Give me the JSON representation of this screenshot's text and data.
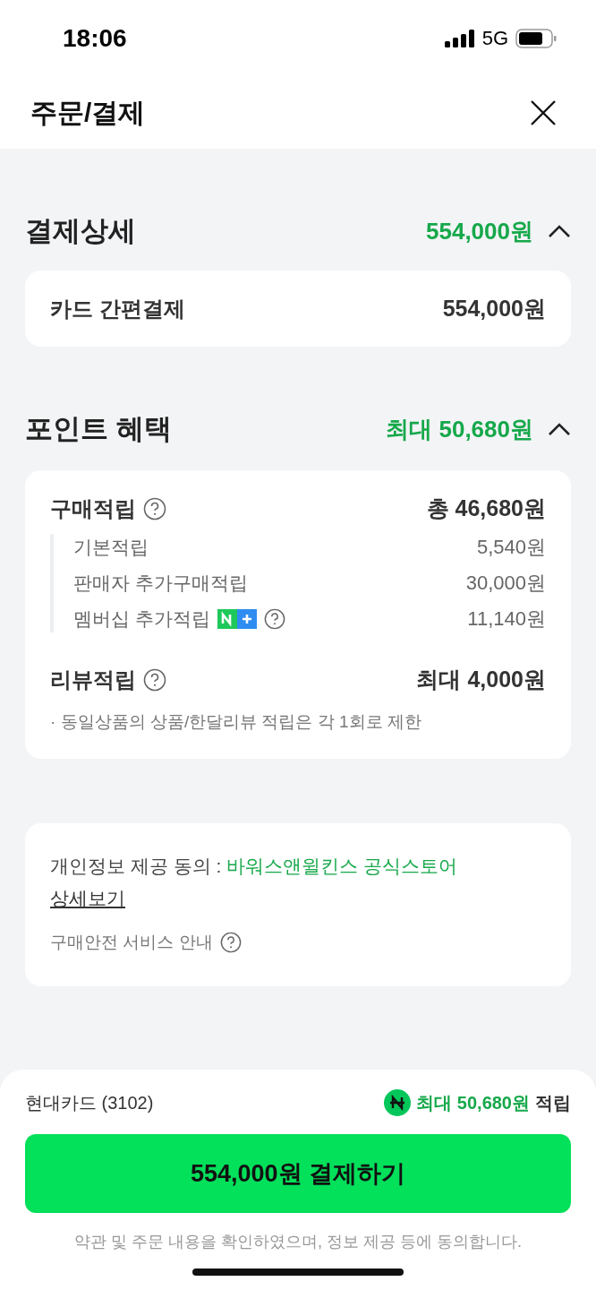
{
  "status_bar": {
    "time": "18:06",
    "network": "5G"
  },
  "header": {
    "title": "주문/결제"
  },
  "payment_detail": {
    "title": "결제상세",
    "total": "554,000원",
    "expanded": true,
    "rows": [
      {
        "label": "카드 간편결제",
        "value": "554,000원"
      }
    ]
  },
  "points": {
    "title": "포인트 혜택",
    "total": "최대 50,680원",
    "expanded": true,
    "groups": [
      {
        "label": "구매적립",
        "value": "총 46,680원",
        "items": [
          {
            "label": "기본적립",
            "value": "5,540원",
            "membership_badge": false,
            "help": false
          },
          {
            "label": "판매자 추가구매적립",
            "value": "30,000원",
            "membership_badge": false,
            "help": false
          },
          {
            "label": "멤버십 추가적립",
            "value": "11,140원",
            "membership_badge": true,
            "help": true
          }
        ]
      },
      {
        "label": "리뷰적립",
        "value": "최대 4,000원",
        "note": "· 동일상품의 상품/한달리뷰 적립은 각 1회로 제한"
      }
    ]
  },
  "notice": {
    "consent_label": "개인정보 제공 동의 : ",
    "consent_store": "바워스앤윌킨스 공식스토어",
    "detail_link": "상세보기",
    "safety_label": "구매안전 서비스 안내"
  },
  "footer": {
    "card": "현대카드 (3102)",
    "reward_amount": "최대 50,680원",
    "reward_suffix": "적립",
    "pay_button": "554,000원 결제하기",
    "agreement": "약관 및 주문 내용을 확인하였으며, 정보 제공 등에 동의합니다."
  }
}
